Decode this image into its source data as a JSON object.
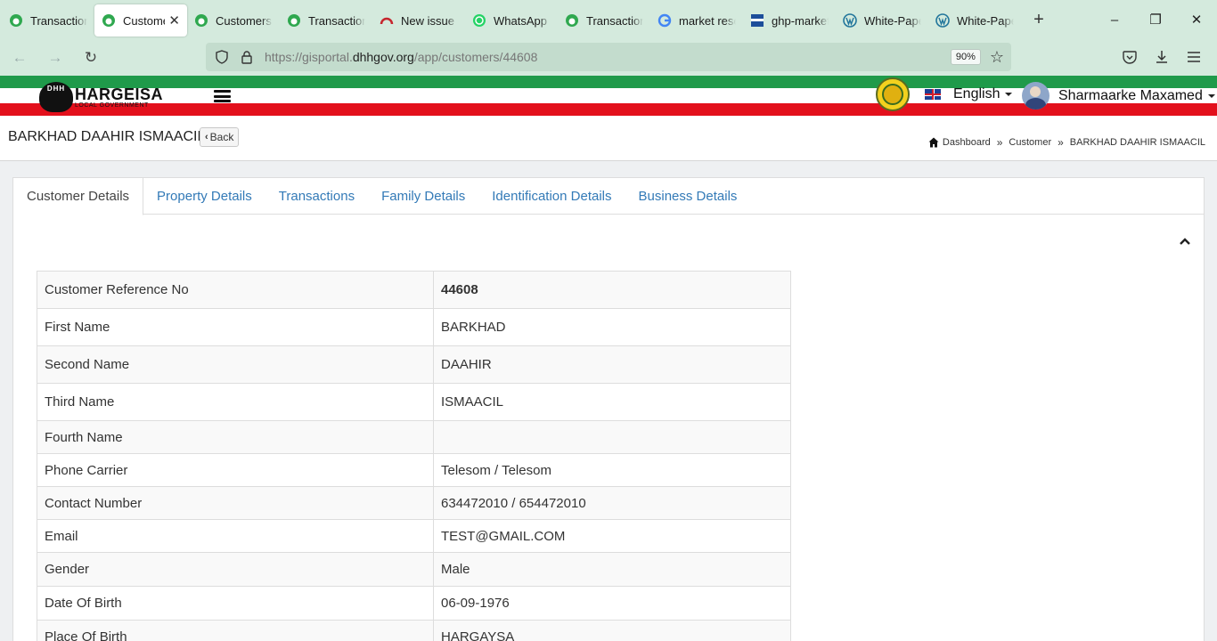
{
  "browser": {
    "tabs": [
      {
        "title": "Transactions",
        "icon": "app-icon",
        "active": false
      },
      {
        "title": "Customers",
        "icon": "app-icon",
        "active": true
      },
      {
        "title": "Customers |",
        "icon": "app-icon",
        "active": false
      },
      {
        "title": "Transactions",
        "icon": "app-icon",
        "active": false
      },
      {
        "title": "New issue · ",
        "icon": "gitlab-icon",
        "active": false
      },
      {
        "title": "WhatsApp",
        "icon": "whatsapp-icon",
        "active": false
      },
      {
        "title": "Transactions",
        "icon": "app-icon",
        "active": false
      },
      {
        "title": "market rese",
        "icon": "google-icon",
        "active": false
      },
      {
        "title": "ghp-market",
        "icon": "b2b-icon",
        "active": false
      },
      {
        "title": "White-Paper",
        "icon": "wordpress-icon",
        "active": false
      },
      {
        "title": "White-Paper",
        "icon": "wordpress-icon",
        "active": false
      }
    ],
    "url_prefix": "https://gisportal.",
    "url_domain": "dhhgov.org",
    "url_path": "/app/customers/44608",
    "zoom": "90%"
  },
  "app": {
    "logo_text": "HARGEISA",
    "logo_sub": "LOCAL GOVERNMENT",
    "logo_mark": "DHH",
    "language": "English",
    "user_name": "Sharmaarke Maxamed"
  },
  "page": {
    "title": "BARKHAD DAAHIR ISMAACIL",
    "back_label": "Back",
    "breadcrumb": [
      "Dashboard",
      "Customer",
      "BARKHAD DAAHIR ISMAACIL"
    ]
  },
  "tabs": [
    "Customer Details",
    "Property Details",
    "Transactions",
    "Family Details",
    "Identification Details",
    "Business Details"
  ],
  "details": [
    {
      "label": "Customer Reference No",
      "value": "44608",
      "bold": true,
      "h": 42
    },
    {
      "label": "First Name",
      "value": "BARKHAD",
      "h": 42
    },
    {
      "label": "Second Name",
      "value": "DAAHIR",
      "h": 42
    },
    {
      "label": "Third Name",
      "value": "ISMAACIL",
      "h": 42
    },
    {
      "label": "Fourth Name",
      "value": "",
      "h": 37
    },
    {
      "label": "Phone Carrier",
      "value": "Telesom / Telesom",
      "h": 37
    },
    {
      "label": "Contact Number",
      "value": "634472010 / 654472010",
      "h": 37
    },
    {
      "label": "Email",
      "value": "TEST@GMAIL.COM",
      "h": 37
    },
    {
      "label": "Gender",
      "value": "Male",
      "h": 38
    },
    {
      "label": "Date Of Birth",
      "value": "06-09-1976",
      "h": 38
    },
    {
      "label": "Place Of Birth",
      "value": "HARGAYSA",
      "h": 38
    }
  ]
}
